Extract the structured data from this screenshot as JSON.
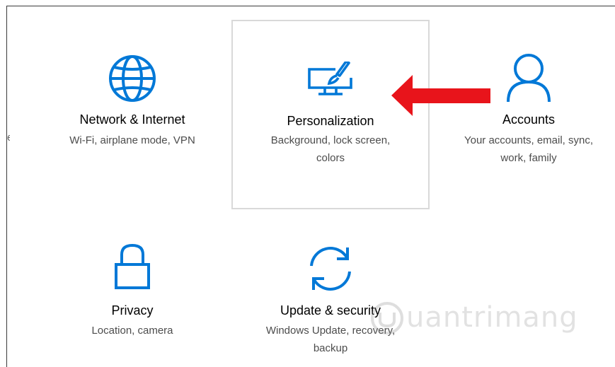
{
  "tiles": {
    "network": {
      "title": "Network & Internet",
      "desc_line1": "Wi-Fi, airplane mode, VPN",
      "desc_line2": ""
    },
    "personalization": {
      "title": "Personalization",
      "desc_line1": "Background, lock screen,",
      "desc_line2": "colors",
      "selected": true
    },
    "accounts": {
      "title": "Accounts",
      "desc_line1": "Your accounts, email, sync,",
      "desc_line2": "work, family"
    },
    "privacy": {
      "title": "Privacy",
      "desc_line1": "Location, camera",
      "desc_line2": ""
    },
    "update": {
      "title": "Update & security",
      "desc_line1": "Windows Update, recovery,",
      "desc_line2": "backup"
    }
  },
  "icons": {
    "network": "globe-icon",
    "personalization": "paintbrush-monitor-icon",
    "accounts": "person-icon",
    "privacy": "lock-icon",
    "update": "sync-icon"
  },
  "annotation": {
    "arrow_icon": "red-arrow-left-icon",
    "arrow_color": "#e8141b"
  },
  "watermark": {
    "text": "uantrimang"
  },
  "colors": {
    "icon_blue": "#0078d7",
    "selected_border": "#d9d9d9"
  }
}
